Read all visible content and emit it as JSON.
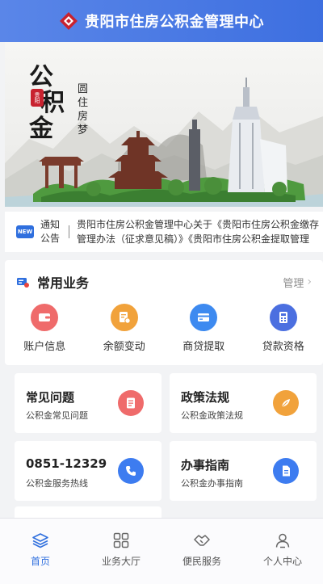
{
  "header": {
    "title": "贵阳市住房公积金管理中心",
    "logo_icon": "diamond-logo-icon"
  },
  "banner": {
    "calligraphy_main": [
      "公",
      "积",
      "金"
    ],
    "seal_text": "贵阳",
    "calligraphy_side": [
      "圆",
      "住",
      "房",
      "梦"
    ]
  },
  "notice": {
    "badge": "NEW",
    "label_line1": "通知",
    "label_line2": "公告",
    "text": "贵阳市住房公积金管理中心关于《贵阳市住房公积金缴存管理办法（征求意见稿）》《贵阳市住房公积金提取管理"
  },
  "services": {
    "title": "常用业务",
    "manage": "管理",
    "items": [
      {
        "label": "账户信息",
        "icon": "wallet-icon",
        "color": "#ef6b6b"
      },
      {
        "label": "余额变动",
        "icon": "document-coin-icon",
        "color": "#f1a23b"
      },
      {
        "label": "商贷提取",
        "icon": "credit-card-icon",
        "color": "#3d8af0"
      },
      {
        "label": "贷款资格",
        "icon": "calculator-icon",
        "color": "#4b6fe0"
      }
    ]
  },
  "cards": [
    {
      "title": "常见问题",
      "subtitle": "公积金常见问题",
      "icon": "document-icon",
      "color": "#ef6b6b"
    },
    {
      "title": "政策法规",
      "subtitle": "公积金政策法规",
      "icon": "feather-icon",
      "color": "#f1a23b"
    },
    {
      "title": "0851-12329",
      "subtitle": "公积金服务热线",
      "icon": "phone-icon",
      "color": "#3d7cf0"
    },
    {
      "title": "办事指南",
      "subtitle": "公积金办事指南",
      "icon": "guide-document-icon",
      "color": "#3d7cf0"
    }
  ],
  "tabbar": [
    {
      "label": "首页",
      "icon": "layers-icon",
      "active": true
    },
    {
      "label": "业务大厅",
      "icon": "grid-icon",
      "active": false
    },
    {
      "label": "便民服务",
      "icon": "handshake-icon",
      "active": false
    },
    {
      "label": "个人中心",
      "icon": "person-icon",
      "active": false
    }
  ],
  "colors": {
    "primary": "#2f6fde",
    "header": "#3d6fe0"
  }
}
